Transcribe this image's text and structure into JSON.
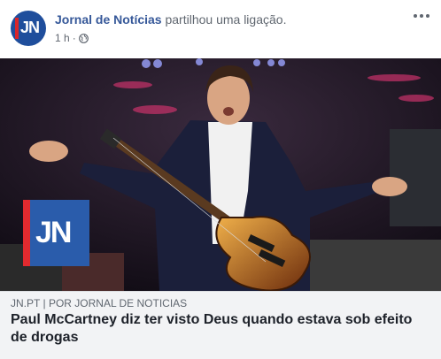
{
  "post": {
    "page_name": "Jornal de Notícias",
    "action": " partilhou uma ligação.",
    "time": "1 h",
    "separator": "·",
    "avatar_letters": "JN"
  },
  "link": {
    "badge_letters": "JN",
    "domain": "JN.PT",
    "divider": "|",
    "byline": "POR JORNAL DE NOTICIAS",
    "headline": "Paul McCartney diz ter visto Deus quando estava sob efeito de drogas"
  },
  "icons": {
    "more": "more-options-icon",
    "privacy": "globe-icon"
  },
  "colors": {
    "page_name": "#365899",
    "meta_text": "#606770",
    "headline": "#1d2129",
    "caption_bg": "#f2f3f5",
    "brand_blue": "#2a5cab",
    "brand_red": "#e22a2f"
  }
}
